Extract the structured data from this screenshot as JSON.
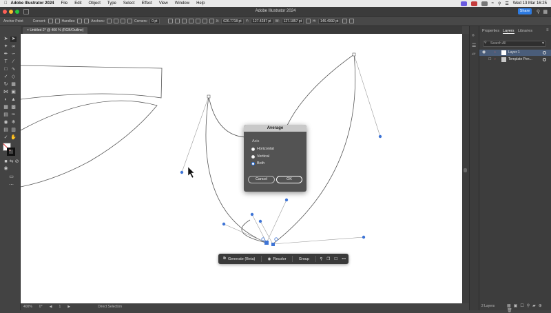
{
  "menubar": {
    "app_name": "Adobe Illustrator 2024",
    "items": [
      "File",
      "Edit",
      "Object",
      "Type",
      "Select",
      "Effect",
      "View",
      "Window",
      "Help"
    ],
    "clock": "Wed 13 Mar  16:25"
  },
  "window": {
    "title": "Adobe Illustrator 2024",
    "share_label": "Share"
  },
  "control_bar": {
    "tool_label": "Anchor Point",
    "convert_label": "Convert:",
    "handles_label": "Handles:",
    "anchors_label": "Anchors:",
    "corners_label": "Corners:",
    "corners_value": "0 pt",
    "x_label": "X:",
    "x_value": "626.7718 pt",
    "y_label": "Y:",
    "y_value": "127.4287 pt",
    "w_label": "W:",
    "w_value": "127.1857 pt",
    "h_label": "H:",
    "h_value": "146.4992 pt"
  },
  "document_tab": {
    "label": "Untitled-2* @ 400 % (RGB/Outline)"
  },
  "dialog": {
    "title": "Average",
    "axis_label": "Axis",
    "options": [
      {
        "label": "Horizontal",
        "selected": false
      },
      {
        "label": "Vertical",
        "selected": false
      },
      {
        "label": "Both",
        "selected": true
      }
    ],
    "cancel_label": "Cancel",
    "ok_label": "OK"
  },
  "task_bar": {
    "generate_label": "Generate (Beta)",
    "recolor_label": "Recolor",
    "group_label": "Group",
    "more_label": "•••"
  },
  "panel": {
    "tabs": [
      "Properties",
      "Layers",
      "Libraries"
    ],
    "active_tab": "Layers",
    "search_placeholder": "Search All",
    "layers": [
      {
        "name": "Layer 1"
      },
      {
        "name": "Template Pen..."
      }
    ],
    "layer_count": "2 Layers"
  },
  "status_bar": {
    "zoom": "400%",
    "rotation": "0°",
    "artboard": "1",
    "tool": "Direct Selection"
  },
  "colors": {
    "accent": "#2b75e6",
    "anchor": "#3e74d6"
  }
}
